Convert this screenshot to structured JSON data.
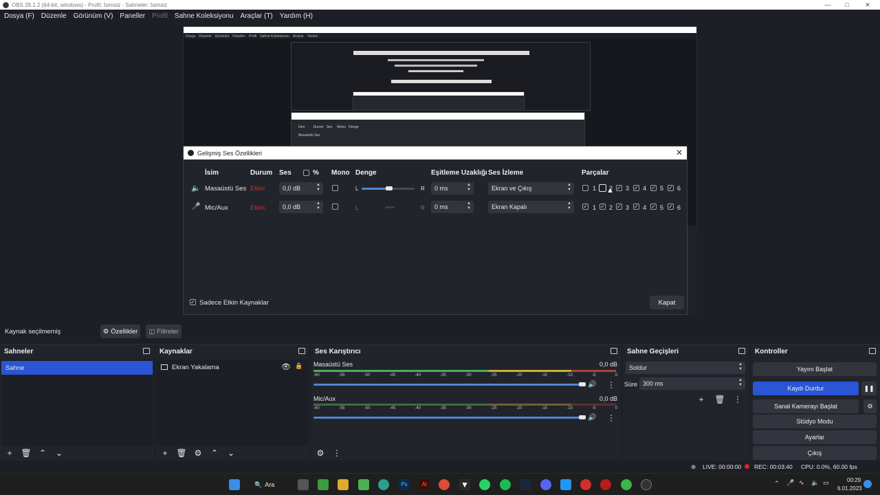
{
  "window": {
    "title": "OBS 28.1.2 (64-bit, windows) - Profil: İsimsiz - Sahneler: İsimsiz"
  },
  "menu": [
    {
      "label": "Dosya (F)",
      "enabled": true
    },
    {
      "label": "Düzenle",
      "enabled": true
    },
    {
      "label": "Görünüm (V)",
      "enabled": true
    },
    {
      "label": "Paneller",
      "enabled": true
    },
    {
      "label": "Profil",
      "enabled": false
    },
    {
      "label": "Sahne Koleksiyonu",
      "enabled": true
    },
    {
      "label": "Araçlar (T)",
      "enabled": true
    },
    {
      "label": "Yardım (H)",
      "enabled": true
    }
  ],
  "dialog": {
    "title": "Gelişmiş Ses Özellikleri",
    "headers": {
      "name": "İsim",
      "status": "Durum",
      "volume": "Ses",
      "percent": "%",
      "mono": "Mono",
      "balance": "Denge",
      "sync_offset": "Eşitleme Uzaklığı",
      "monitoring": "Ses İzleme",
      "tracks": "Parçalar"
    },
    "rows": [
      {
        "name": "Masaüstü Ses",
        "status": "Etkin",
        "volume": "0,0 dB",
        "mono": false,
        "balance_left": "L",
        "balance_right": "R",
        "balance_level": 0.5,
        "sync": "0 ms",
        "monitoring": "Ekran ve Çıkış",
        "tracks": [
          false,
          false,
          true,
          true,
          true,
          true
        ]
      },
      {
        "name": "Mic/Aux",
        "status": "Etkin",
        "volume": "0,0 dB",
        "mono": false,
        "balance_left": "L",
        "balance_right": "R",
        "balance_level": 0.5,
        "sync": "0 ms",
        "monitoring": "Ekran Kapalı",
        "tracks": [
          true,
          true,
          true,
          true,
          true,
          true
        ]
      }
    ],
    "track_labels": [
      "1",
      "2",
      "3",
      "4",
      "5",
      "6"
    ],
    "only_active_label": "Sadece Etkin Kaynaklar",
    "only_active_checked": true,
    "close_button": "Kapat"
  },
  "source_bar": {
    "no_source": "Kaynak seçilmemiş",
    "properties": "Özellikler",
    "filters": "Filtreler"
  },
  "docks": {
    "scenes": {
      "title": "Sahneler",
      "items": [
        "Sahne"
      ]
    },
    "sources": {
      "title": "Kaynaklar",
      "items": [
        "Ekran Yakalama"
      ]
    },
    "mixer": {
      "title": "Ses Karıştırıcı",
      "channels": [
        {
          "name": "Masaüstü Ses",
          "db": "0,0 dB",
          "level": 0.93
        },
        {
          "name": "Mic/Aux",
          "db": "0,0 dB",
          "level": 0.93
        }
      ],
      "scale": [
        "-60",
        "-55",
        "-50",
        "-45",
        "-40",
        "-35",
        "-30",
        "-25",
        "-20",
        "-15",
        "-10",
        "-5",
        "0"
      ]
    },
    "transitions": {
      "title": "Sahne Geçişleri",
      "transition": "Soldur",
      "duration_label": "Süre",
      "duration_value": "300 ms"
    },
    "controls": {
      "title": "Kontroller",
      "buttons": [
        "Yayını Başlat",
        "Kaydı Durdur",
        "Sanal Kamerayı Başlat",
        "Stüdyo Modu",
        "Ayarlar",
        "Çıkış"
      ],
      "active_color": "#2a55d4"
    }
  },
  "status": {
    "live": "LIVE: 00:00:00",
    "rec": "REC: 00:03:40",
    "cpu": "CPU: 0.0%, 60.00 fps"
  },
  "taskbar": {
    "search": "Ara",
    "time": "00:29",
    "date": "6.01.2023"
  },
  "colors": {
    "accent": "#2a55d4",
    "status_red": "#d9262b",
    "meter_green": "#4caf50",
    "meter_yellow": "#c7b13a",
    "meter_red": "#b0413a"
  }
}
